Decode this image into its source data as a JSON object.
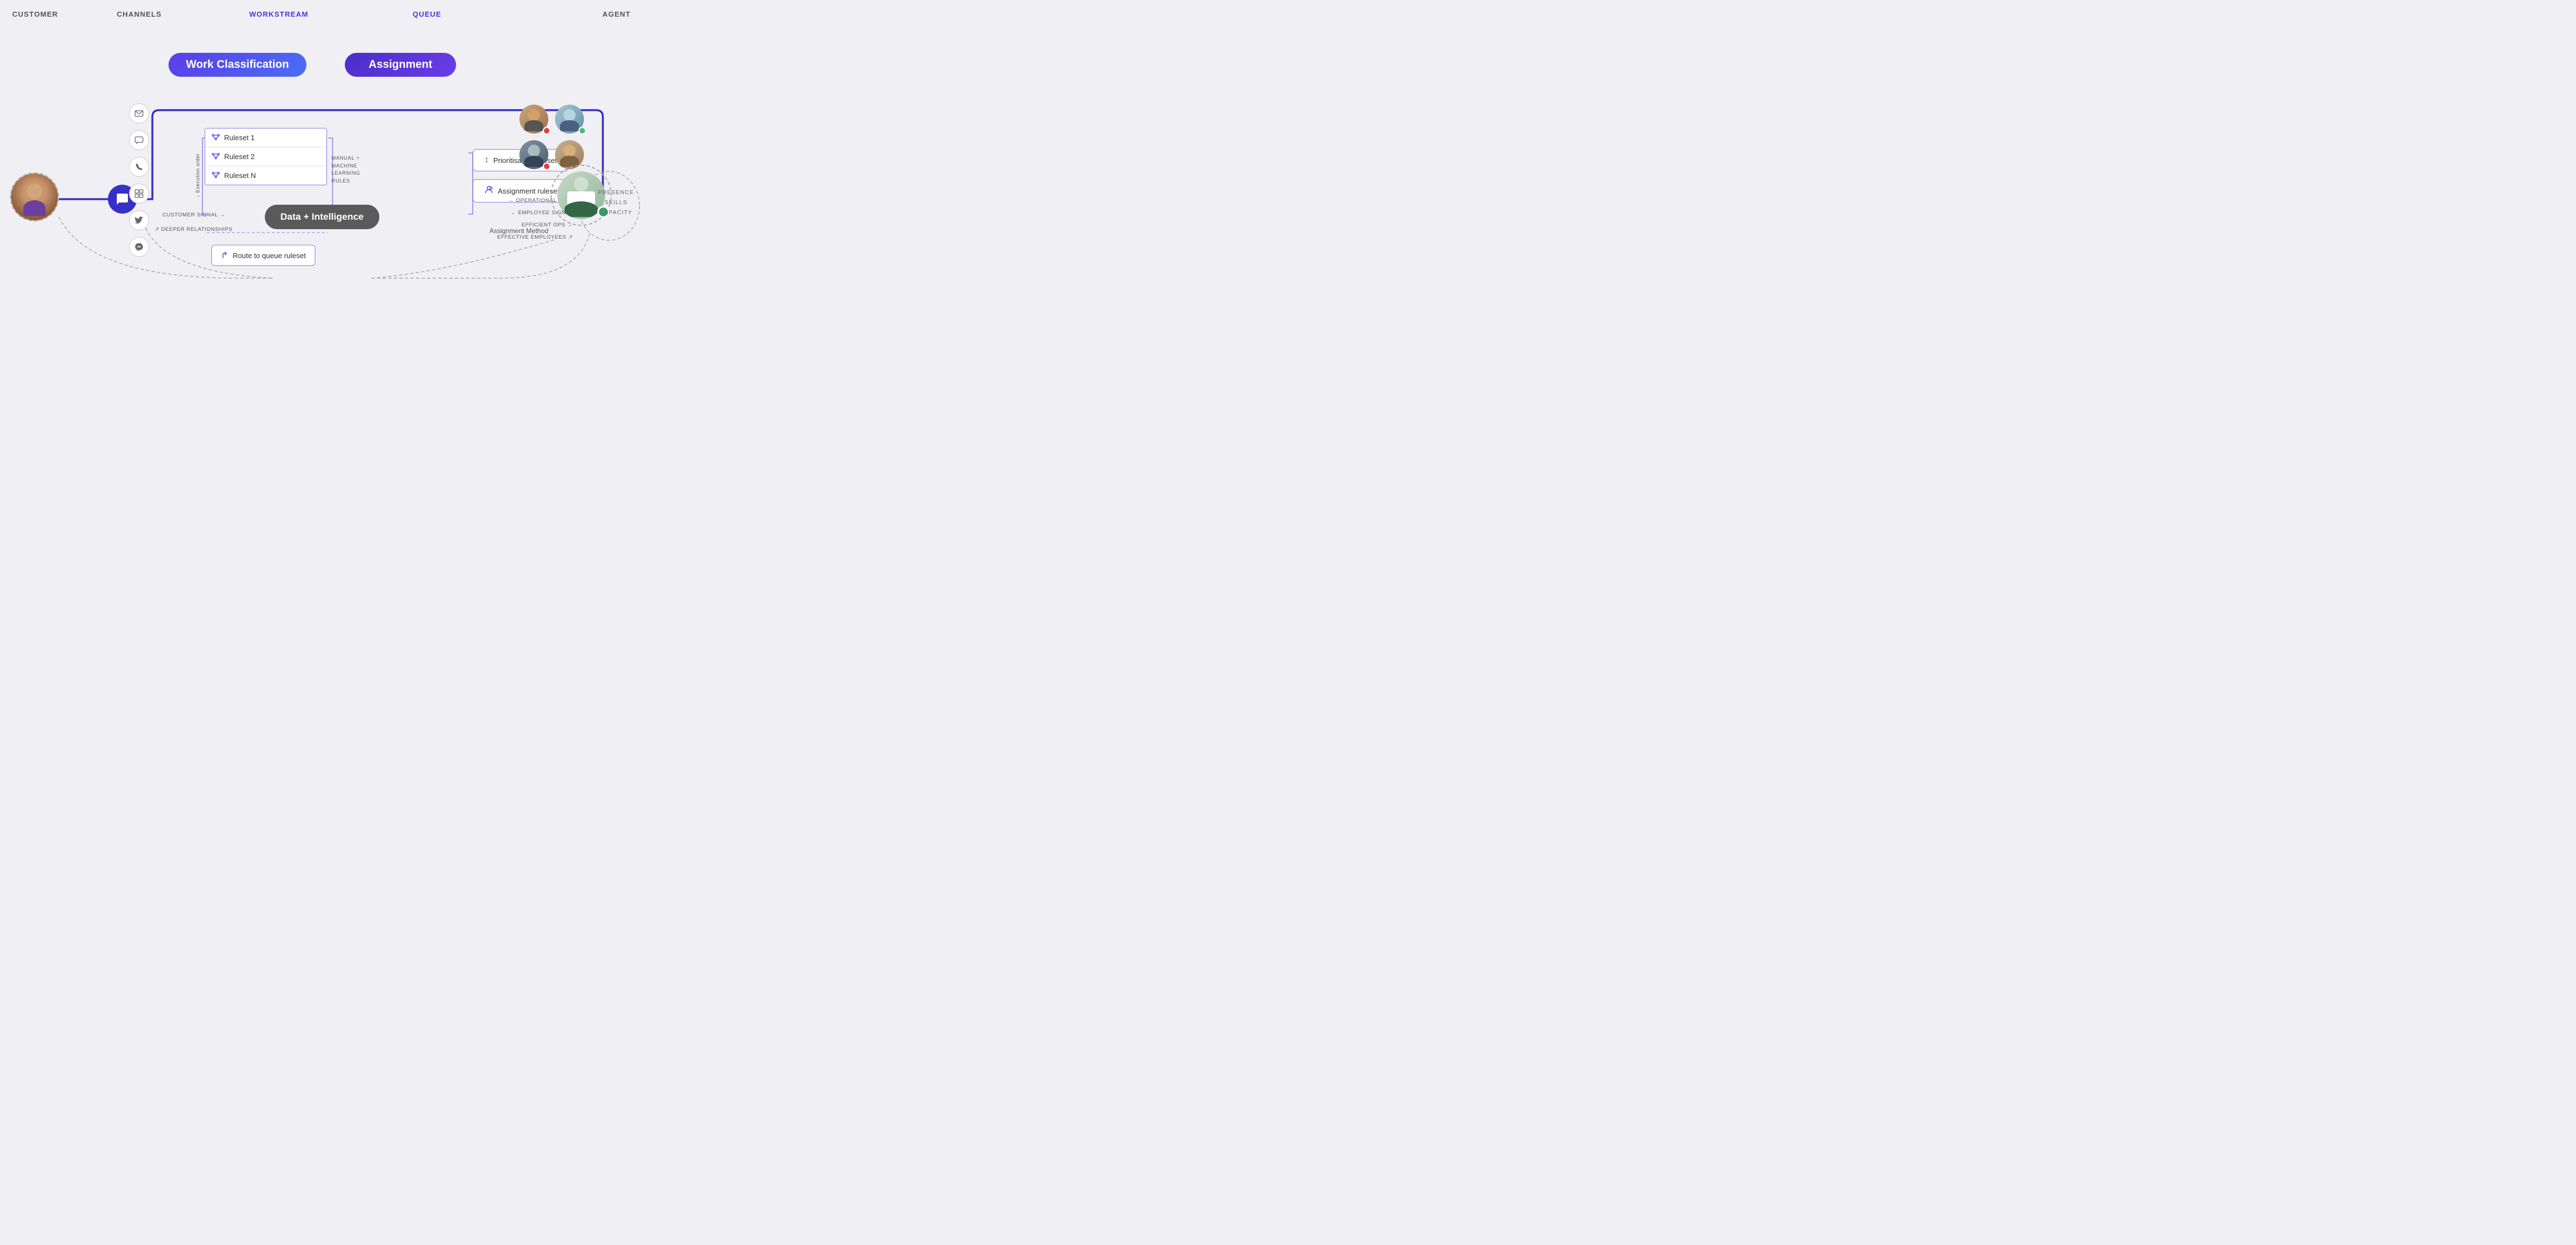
{
  "headers": {
    "customer": "CUSTOMER",
    "channels": "CHANNELS",
    "workstream": "WORKSTREAM",
    "queue": "QUEUE",
    "agent": "AGENT"
  },
  "badges": {
    "work_classification": "Work Classification",
    "assignment": "Assignment",
    "data_intelligence": "Data + Intelligence"
  },
  "rulesets": [
    {
      "label": "Ruleset 1"
    },
    {
      "label": "Ruleset 2"
    },
    {
      "label": "Ruleset N"
    }
  ],
  "ml_rules": "MANUAL +\nMACHINE\nLEARNING\nRULES",
  "execution_order": "↓ Execution order",
  "route_queue": "Route to queue ruleset",
  "assignment_boxes": [
    {
      "label": "Prioritisation ruleset",
      "icon": "↕"
    },
    {
      "label": "Assignment ruleset",
      "icon": "👤"
    }
  ],
  "assignment_method": "Assignment Method",
  "data_labels_left": [
    "CUSTOMER SIGNAL →",
    "↗ DEEPER RELATIONSHIPS"
  ],
  "data_labels_right": [
    "← OPERATIONAL DATA",
    "← EMPLOYEE SIGNAL",
    "EFFICIENT OPS →",
    "EFFECTIVE EMPLOYEES ↗"
  ],
  "agent_info": {
    "presence": "PRESENCE",
    "skills": "SKILLS",
    "capacity": "CAPACITY"
  },
  "channel_icons": [
    "✉",
    "💬",
    "☎",
    "◈",
    "🐦",
    "💬"
  ]
}
